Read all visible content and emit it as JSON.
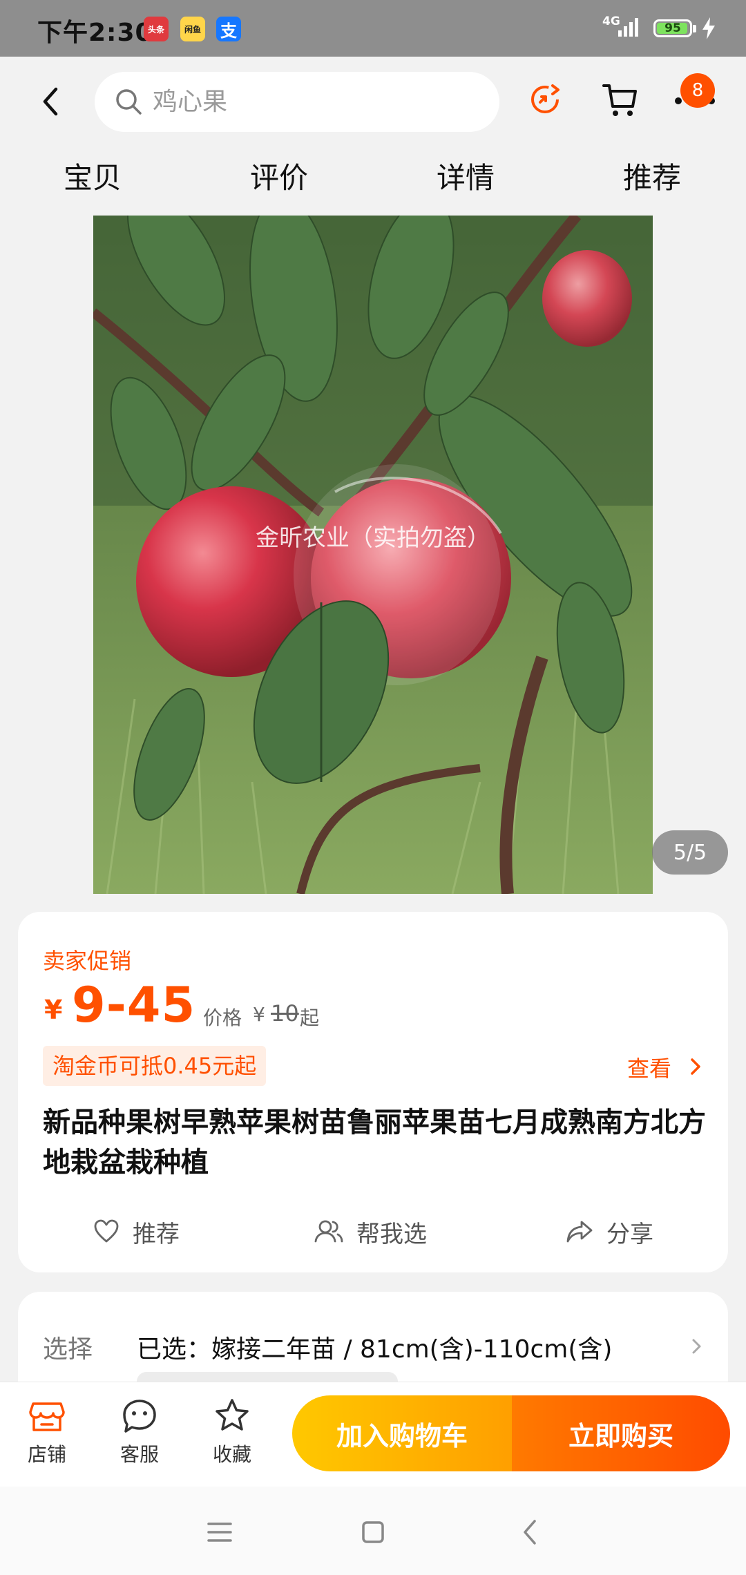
{
  "status_bar": {
    "time": "下午2:30",
    "apps": [
      "头条",
      "闲鱼",
      "支"
    ],
    "network": "4G",
    "battery": "95"
  },
  "header": {
    "search_value": "鸡心果",
    "cart_badge": "8"
  },
  "tabs": [
    "宝贝",
    "评价",
    "详情",
    "推荐"
  ],
  "gallery": {
    "counter": "5/5",
    "watermark": "金昕农业（实拍勿盗）"
  },
  "price": {
    "promo_label": "卖家促销",
    "currency": "¥",
    "range": "9-45",
    "original_label": "价格",
    "original_currency": "¥",
    "original_value": "10",
    "original_suffix": "起",
    "coin_offer": "淘金币可抵0.45元起",
    "view_label": "查看"
  },
  "product": {
    "title": "新品种果树早熟苹果树苗鲁丽苹果苗七月成熟南方北方地栽盆栽种植"
  },
  "actions": {
    "recommend": "推荐",
    "help_choose": "帮我选",
    "share": "分享"
  },
  "selection": {
    "label": "选择",
    "value": "已选：嫁接二年苗 / 81cm(含)-110cm(含)"
  },
  "bottom_bar": {
    "shop": "店铺",
    "service": "客服",
    "favorite": "收藏",
    "add_to_cart": "加入购物车",
    "buy_now": "立即购买"
  },
  "colors": {
    "accent": "#ff5000",
    "cart_gradient_start": "#ffc800",
    "buy_gradient_end": "#ff4b00"
  }
}
